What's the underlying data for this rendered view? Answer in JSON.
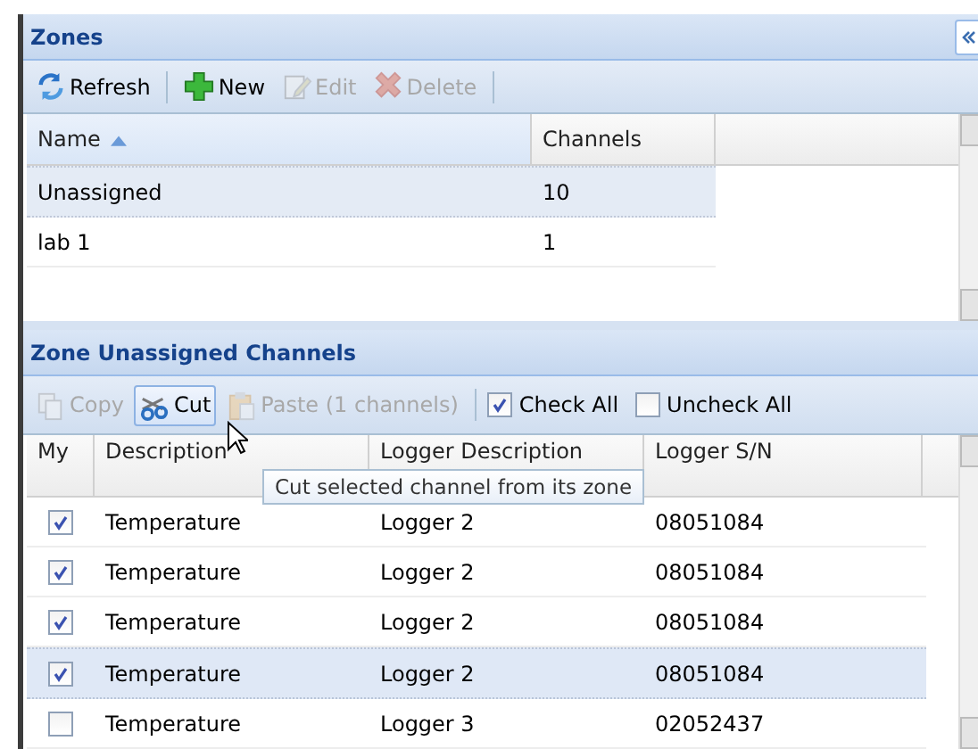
{
  "zones": {
    "title": "Zones",
    "toolbar": [
      {
        "kind": "refresh",
        "label": "Refresh",
        "disabled": false
      },
      {
        "kind": "separator"
      },
      {
        "kind": "new",
        "label": "New",
        "disabled": false
      },
      {
        "kind": "edit",
        "label": "Edit",
        "disabled": true
      },
      {
        "kind": "delete",
        "label": "Delete",
        "disabled": true
      },
      {
        "kind": "separator"
      }
    ],
    "columns": [
      {
        "label": "Name",
        "sorted": true
      },
      {
        "label": "Channels",
        "sorted": false
      }
    ],
    "rows": [
      {
        "name": "Unassigned",
        "channels": "10",
        "selected": true
      },
      {
        "name": "lab 1",
        "channels": "1",
        "selected": false
      }
    ]
  },
  "channels": {
    "title": "Zone Unassigned Channels",
    "toolbar": [
      {
        "kind": "copy",
        "label": "Copy",
        "disabled": true,
        "hovered": false
      },
      {
        "kind": "cut",
        "label": "Cut",
        "disabled": false,
        "hovered": true
      },
      {
        "kind": "paste",
        "label": "Paste (1 channels)",
        "disabled": true,
        "hovered": false
      },
      {
        "kind": "separator"
      },
      {
        "kind": "checkbox",
        "label": "Check All",
        "checked": true
      },
      {
        "kind": "checkbox",
        "label": "Uncheck All",
        "checked": false
      }
    ],
    "columns": [
      {
        "label": "My"
      },
      {
        "label": "Description"
      },
      {
        "label": "Logger Description"
      },
      {
        "label": "Logger S/N"
      }
    ],
    "rows": [
      {
        "checked": true,
        "description": "Temperature",
        "logger": "Logger 2",
        "serial": "08051084",
        "selected": false
      },
      {
        "checked": true,
        "description": "Temperature",
        "logger": "Logger 2",
        "serial": "08051084",
        "selected": false
      },
      {
        "checked": true,
        "description": "Temperature",
        "logger": "Logger 2",
        "serial": "08051084",
        "selected": false
      },
      {
        "checked": true,
        "description": "Temperature",
        "logger": "Logger 2",
        "serial": "08051084",
        "selected": true
      },
      {
        "checked": false,
        "description": "Temperature",
        "logger": "Logger 3",
        "serial": "02052437",
        "selected": false
      }
    ],
    "tooltip": "Cut selected channel from its zone"
  }
}
